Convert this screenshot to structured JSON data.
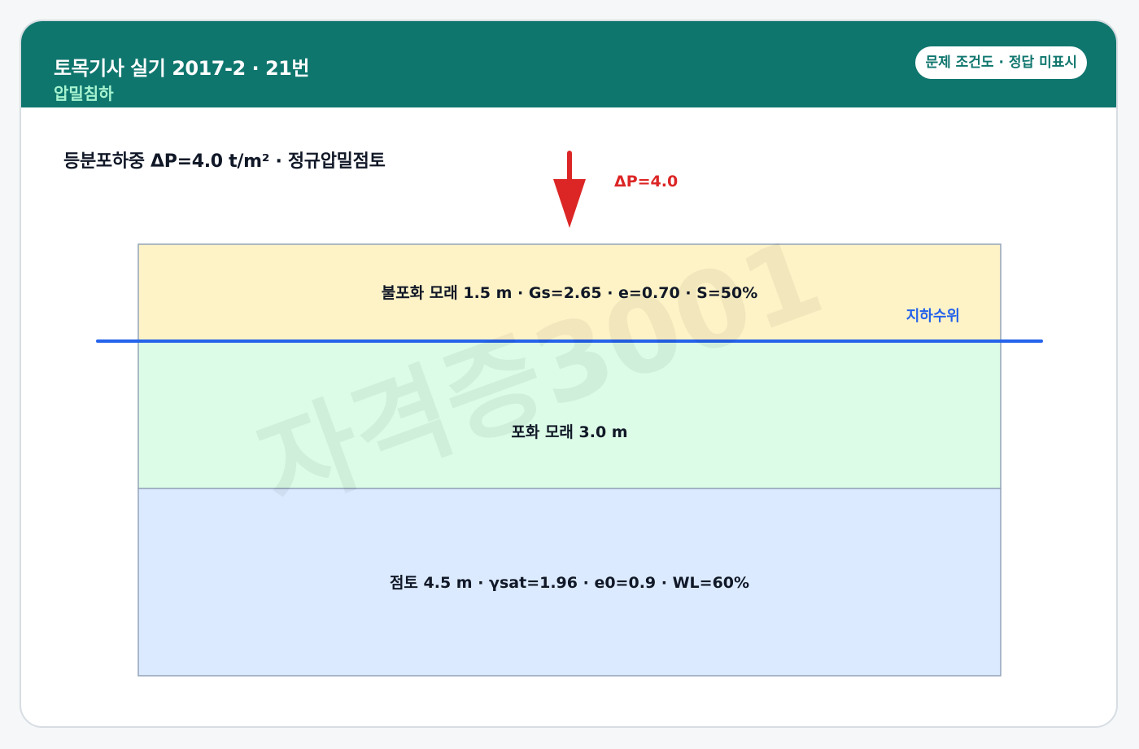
{
  "header": {
    "title": "토목기사 실기 2017-2 · 21번",
    "subtitle": "압밀침하",
    "badge": "문제 조건도 · 정답 미표시"
  },
  "diagram": {
    "title": "등분포하중 ΔP=4.0 t/m² · 정규압밀점토",
    "load": {
      "label": "ΔP=4.0",
      "color": "#dc2626"
    },
    "groundwater": {
      "label": "지하수위",
      "color": "#2563eb"
    },
    "layers": [
      {
        "label": "불포화 모래 1.5 m · Gs=2.65 · e=0.70 · S=50%",
        "thickness_m": 1.5,
        "color": "#fef3c7"
      },
      {
        "label": "포화 모래 3.0 m",
        "thickness_m": 3.0,
        "color": "#dcfce7"
      },
      {
        "label": "점토 4.5 m · γsat=1.96 · e0=0.9 · WL=60%",
        "thickness_m": 4.5,
        "color": "#dbeafe"
      }
    ],
    "watermark": "자격증3001"
  }
}
